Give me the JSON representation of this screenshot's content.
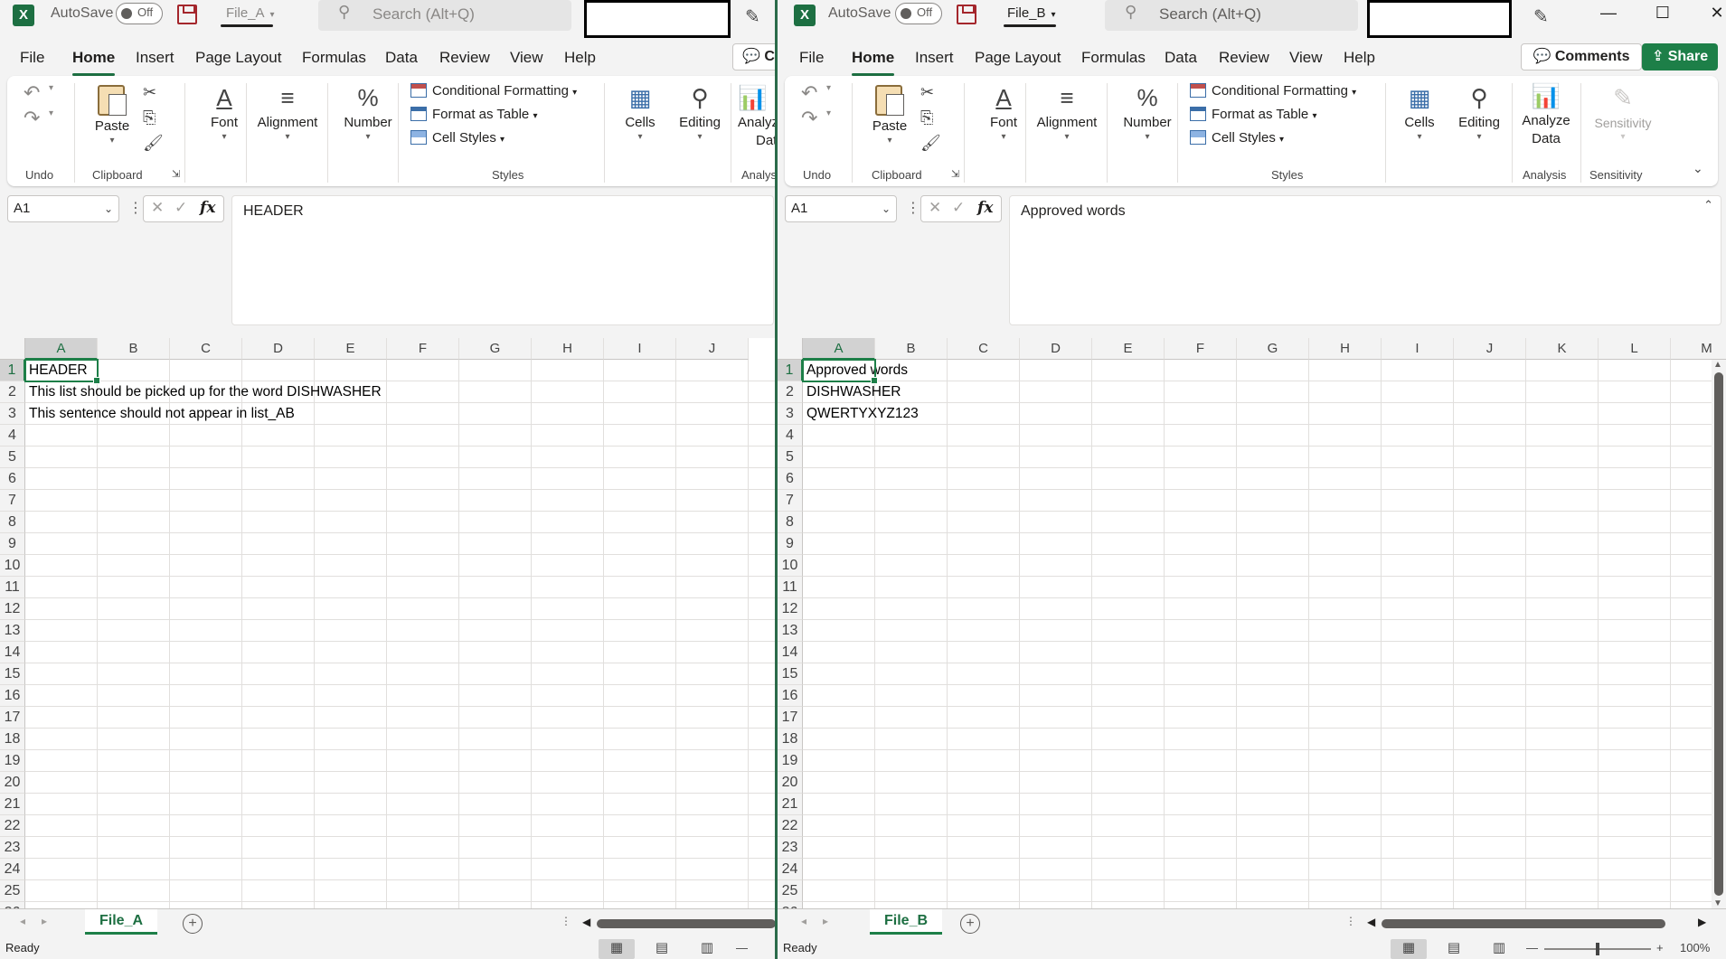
{
  "menu": [
    "File",
    "Home",
    "Insert",
    "Page Layout",
    "Formulas",
    "Data",
    "Review",
    "View",
    "Help"
  ],
  "ribbon": {
    "undo_group": "Undo",
    "clipboard_group": "Clipboard",
    "paste": "Paste",
    "font": "Font",
    "alignment": "Alignment",
    "number": "Number",
    "conditional_formatting": "Conditional Formatting",
    "format_as_table": "Format as Table",
    "cell_styles": "Cell Styles",
    "styles_group": "Styles",
    "cells": "Cells",
    "editing": "Editing",
    "analyze_data_l1": "Analyze",
    "analyze_data_l2": "Data",
    "analyze_clip_a": "Analyz",
    "analyze_clip_b": "Data",
    "analysis_group": "Analysis",
    "analysis_clip": "Analysis",
    "sensitivity": "Sensitivity",
    "sensitivity_group": "Sensitivity"
  },
  "common": {
    "autosave": "AutoSave",
    "toggle_off": "Off",
    "search_placeholder": "Search (Alt+Q)",
    "status": "Ready",
    "comments": "Comments",
    "share": "Share",
    "comments_clip": "Co",
    "zoom": "100%",
    "colors": {
      "excel_green": "#1d7f48",
      "ribbon_bg": "#ffffff",
      "chrome_bg": "#f3f3f3"
    }
  },
  "windowA": {
    "file_name": "File_A",
    "name_box": "A1",
    "formula": "HEADER",
    "sheet_tab": "File_A",
    "columns": [
      "A",
      "B",
      "C",
      "D",
      "E",
      "F",
      "G",
      "H",
      "I",
      "J"
    ],
    "cells": [
      {
        "ref": "A1",
        "value": "HEADER"
      },
      {
        "ref": "A2",
        "value": "This list should be picked up for the word DISHWASHER"
      },
      {
        "ref": "A3",
        "value": "This sentence should not appear in list_AB"
      }
    ]
  },
  "windowB": {
    "file_name": "File_B",
    "name_box": "A1",
    "formula": "Approved words",
    "sheet_tab": "File_B",
    "columns": [
      "A",
      "B",
      "C",
      "D",
      "E",
      "F",
      "G",
      "H",
      "I",
      "J",
      "K",
      "L",
      "M"
    ],
    "cells": [
      {
        "ref": "A1",
        "value": "Approved words"
      },
      {
        "ref": "A2",
        "value": "DISHWASHER"
      },
      {
        "ref": "A3",
        "value": "QWERTYXYZ123"
      }
    ]
  }
}
